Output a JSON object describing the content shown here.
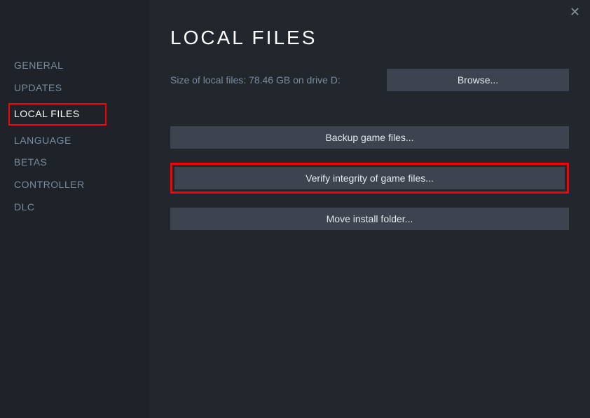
{
  "sidebar": {
    "items": [
      {
        "label": "GENERAL",
        "active": false
      },
      {
        "label": "UPDATES",
        "active": false
      },
      {
        "label": "LOCAL FILES",
        "active": true
      },
      {
        "label": "LANGUAGE",
        "active": false
      },
      {
        "label": "BETAS",
        "active": false
      },
      {
        "label": "CONTROLLER",
        "active": false
      },
      {
        "label": "DLC",
        "active": false
      }
    ]
  },
  "main": {
    "title": "LOCAL FILES",
    "size_text": "Size of local files: 78.46 GB on drive D:",
    "browse_label": "Browse...",
    "backup_label": "Backup game files...",
    "verify_label": "Verify integrity of game files...",
    "move_label": "Move install folder..."
  },
  "close_glyph": "✕"
}
